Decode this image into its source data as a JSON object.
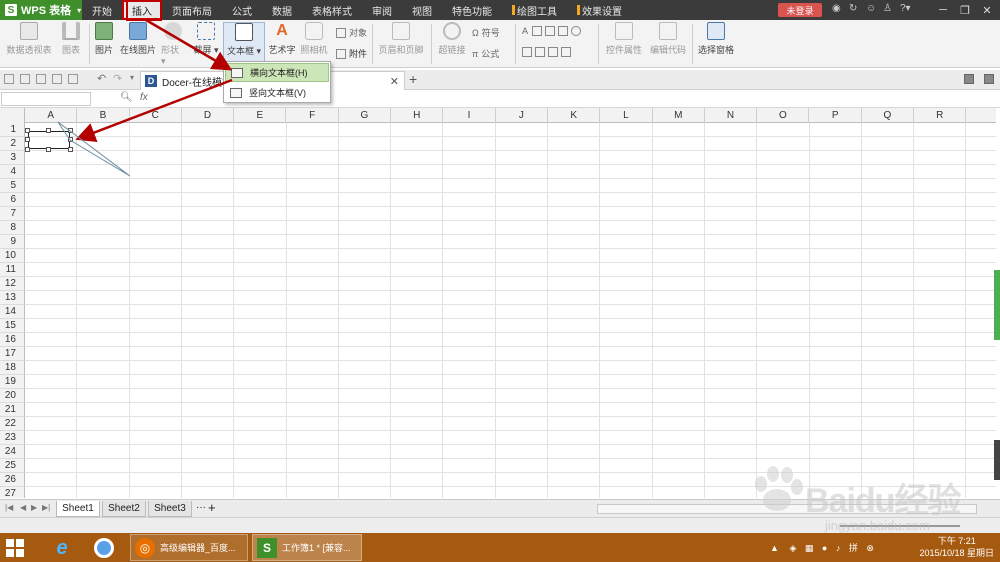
{
  "title_bar": {
    "app_name": "WPS 表格",
    "tabs": [
      "开始",
      "插入",
      "页面布局",
      "公式",
      "数据",
      "表格样式",
      "审阅",
      "视图",
      "特色功能",
      "绘图工具",
      "效果设置"
    ],
    "active_tab": "插入",
    "login_label": "未登录"
  },
  "ribbon": {
    "buttons": [
      {
        "label": "数据透视表",
        "state": "disabled",
        "icon": "pivot-icon"
      },
      {
        "label": "图表",
        "state": "disabled",
        "icon": "chart-icon"
      },
      {
        "label": "图片",
        "state": "enabled",
        "icon": "picture-icon"
      },
      {
        "label": "在线图片",
        "state": "enabled",
        "icon": "online-picture-icon"
      },
      {
        "label": "形状 ▾",
        "state": "disabled",
        "icon": "shape-icon"
      },
      {
        "label": "截屏 ▾",
        "state": "enabled",
        "icon": "screenshot-icon"
      },
      {
        "label": "文本框 ▾",
        "state": "selected",
        "icon": "textbox-icon"
      },
      {
        "label": "艺术字",
        "state": "enabled",
        "icon": "wordart-icon"
      },
      {
        "label": "照相机",
        "state": "disabled",
        "icon": "camera-icon"
      },
      {
        "label": "页眉和页脚",
        "state": "disabled",
        "icon": "header-footer-icon"
      },
      {
        "label": "超链接",
        "state": "disabled",
        "icon": "hyperlink-icon"
      },
      {
        "label": "控件属性",
        "state": "disabled",
        "icon": "control-props-icon"
      },
      {
        "label": "编辑代码",
        "state": "disabled",
        "icon": "edit-code-icon"
      },
      {
        "label": "选择窗格",
        "state": "enabled",
        "icon": "selection-pane-icon"
      }
    ],
    "small_buttons": {
      "object": "对象",
      "attachment": "附件",
      "symbol": "符号",
      "formula": "公式"
    }
  },
  "doc_tab": {
    "label": "Docer-在线模板"
  },
  "formula_bar": {
    "fx_label": "fx"
  },
  "dropdown": {
    "items": [
      "横向文本框(H)",
      "竖向文本框(V)"
    ],
    "highlighted": 0
  },
  "grid": {
    "columns": [
      "A",
      "B",
      "C",
      "D",
      "E",
      "F",
      "G",
      "H",
      "I",
      "J",
      "K",
      "L",
      "M",
      "N",
      "O",
      "P",
      "Q",
      "R"
    ],
    "rows": [
      "1",
      "2",
      "3",
      "4",
      "5",
      "6",
      "7",
      "8",
      "9",
      "10",
      "11",
      "12",
      "13",
      "14",
      "15",
      "16",
      "17",
      "18",
      "19",
      "20",
      "21",
      "22",
      "23",
      "24",
      "25",
      "26",
      "27"
    ]
  },
  "sheet_tabs": {
    "tabs": [
      "Sheet1",
      "Sheet2",
      "Sheet3"
    ],
    "active": "Sheet1",
    "more_label": "···",
    "add_label": "+"
  },
  "watermark": {
    "brand": "Baidu经验",
    "url": "jingyan.baidu.com"
  },
  "taskbar": {
    "apps": [
      {
        "label": "高级编辑器_百度...",
        "icon": "baidu-browser-icon"
      },
      {
        "label": "工作簿1 * [兼容...",
        "icon": "wps-sheet-icon"
      }
    ],
    "clock_time": "下午 7:21",
    "clock_date": "2015/10/18 星期日"
  },
  "colors": {
    "accent_green": "#3f8f2a",
    "annotation_red": "#b30000",
    "taskbar": "#a65a0f",
    "dropdown_highlight": "#cde6b8"
  }
}
